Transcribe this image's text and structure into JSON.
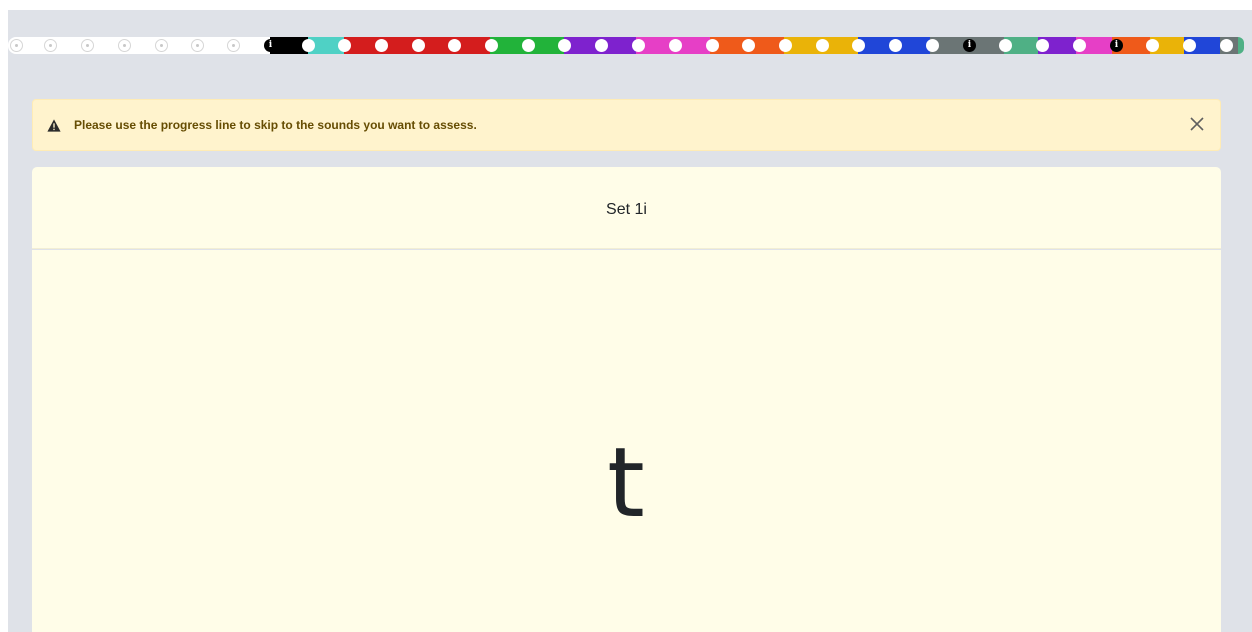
{
  "progress_line": {
    "segment_colors": [
      "#ffffff",
      "#000000",
      "#4fd1c5",
      "#d41d1d",
      "#d41d1d",
      "#22b33a",
      "#22b33a",
      "#7e22ce",
      "#7e22ce",
      "#e63fc6",
      "#e63fc6",
      "#ef5a1a",
      "#ef5a1a",
      "#eab308",
      "#eab308",
      "#2046d8",
      "#2046d8",
      "#6b7575",
      "#6b7575",
      "#4fb085",
      "#7e22ce",
      "#e63fc6",
      "#ef5a1a",
      "#eab308",
      "#2046d8",
      "#6b7575",
      "#4fb085"
    ],
    "info_marker": "i",
    "dots": [
      {
        "state": "inactive"
      },
      {
        "state": "inactive"
      },
      {
        "state": "inactive"
      },
      {
        "state": "inactive"
      },
      {
        "state": "inactive"
      },
      {
        "state": "inactive"
      },
      {
        "state": "inactive"
      },
      {
        "state": "info"
      },
      {
        "state": "active"
      },
      {
        "state": "active"
      },
      {
        "state": "active"
      },
      {
        "state": "active"
      },
      {
        "state": "active"
      },
      {
        "state": "active"
      },
      {
        "state": "active"
      },
      {
        "state": "active"
      },
      {
        "state": "active"
      },
      {
        "state": "active"
      },
      {
        "state": "active"
      },
      {
        "state": "active"
      },
      {
        "state": "active"
      },
      {
        "state": "active"
      },
      {
        "state": "active"
      },
      {
        "state": "active"
      },
      {
        "state": "active"
      },
      {
        "state": "active"
      },
      {
        "state": "info"
      },
      {
        "state": "active"
      },
      {
        "state": "active"
      },
      {
        "state": "active"
      },
      {
        "state": "info"
      },
      {
        "state": "active"
      },
      {
        "state": "active"
      },
      {
        "state": "active"
      }
    ]
  },
  "alert": {
    "icon": "warning-triangle-icon",
    "message": "Please use the progress line to skip to the sounds you want to assess.",
    "close_icon": "close-icon",
    "background": "#fff3cd",
    "text_color": "#664d03"
  },
  "card": {
    "title": "Set 1i",
    "sound": "t",
    "background": "#fffde8"
  }
}
